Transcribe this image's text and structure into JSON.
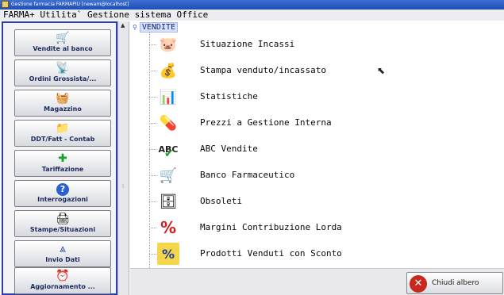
{
  "window": {
    "title": "Gestione farmacia FARMAPIU [newam@localhost]"
  },
  "menubar": {
    "text": "FARMA+ Utilita` Gestione sistema Office"
  },
  "sidebar": {
    "buttons": [
      {
        "label": "Vendite al banco",
        "icon": "shopping-cart-icon"
      },
      {
        "label": "Ordini Grossista/...",
        "icon": "antenna-icon"
      },
      {
        "label": "Magazzino",
        "icon": "basket-icon"
      },
      {
        "label": "DDT/Fatt - Contab",
        "icon": "folder-icon"
      },
      {
        "label": "Tariffazione",
        "icon": "pharmacy-cross-icon"
      },
      {
        "label": "Interrogazioni",
        "icon": "question-icon"
      },
      {
        "label": "Stampe/Situazioni",
        "icon": "printer-icon"
      },
      {
        "label": "Invio Dati",
        "icon": "tower-icon"
      },
      {
        "label": "Aggiornamento ...",
        "icon": "alarm-clock-icon"
      }
    ]
  },
  "tree": {
    "root_label": "VENDITE",
    "items": [
      {
        "label": "Situazione Incassi",
        "icon": "piggy-bank-icon"
      },
      {
        "label": "Stampa venduto/incassato",
        "icon": "money-bag-icon"
      },
      {
        "label": "Statistiche",
        "icon": "bar-chart-icon"
      },
      {
        "label": "Prezzi a Gestione Interna",
        "icon": "pills-icon"
      },
      {
        "label": "ABC Vendite",
        "icon": "abc-check-icon"
      },
      {
        "label": "Banco Farmaceutico",
        "icon": "cart-warning-icon"
      },
      {
        "label": "Obsoleti",
        "icon": "archive-box-icon"
      },
      {
        "label": "Margini Contribuzione Lorda",
        "icon": "percent-icon"
      },
      {
        "label": "Prodotti Venduti con Sconto",
        "icon": "discount-icon"
      }
    ]
  },
  "footer": {
    "close_label": "Chiudi albero",
    "close_icon": "close-icon"
  }
}
